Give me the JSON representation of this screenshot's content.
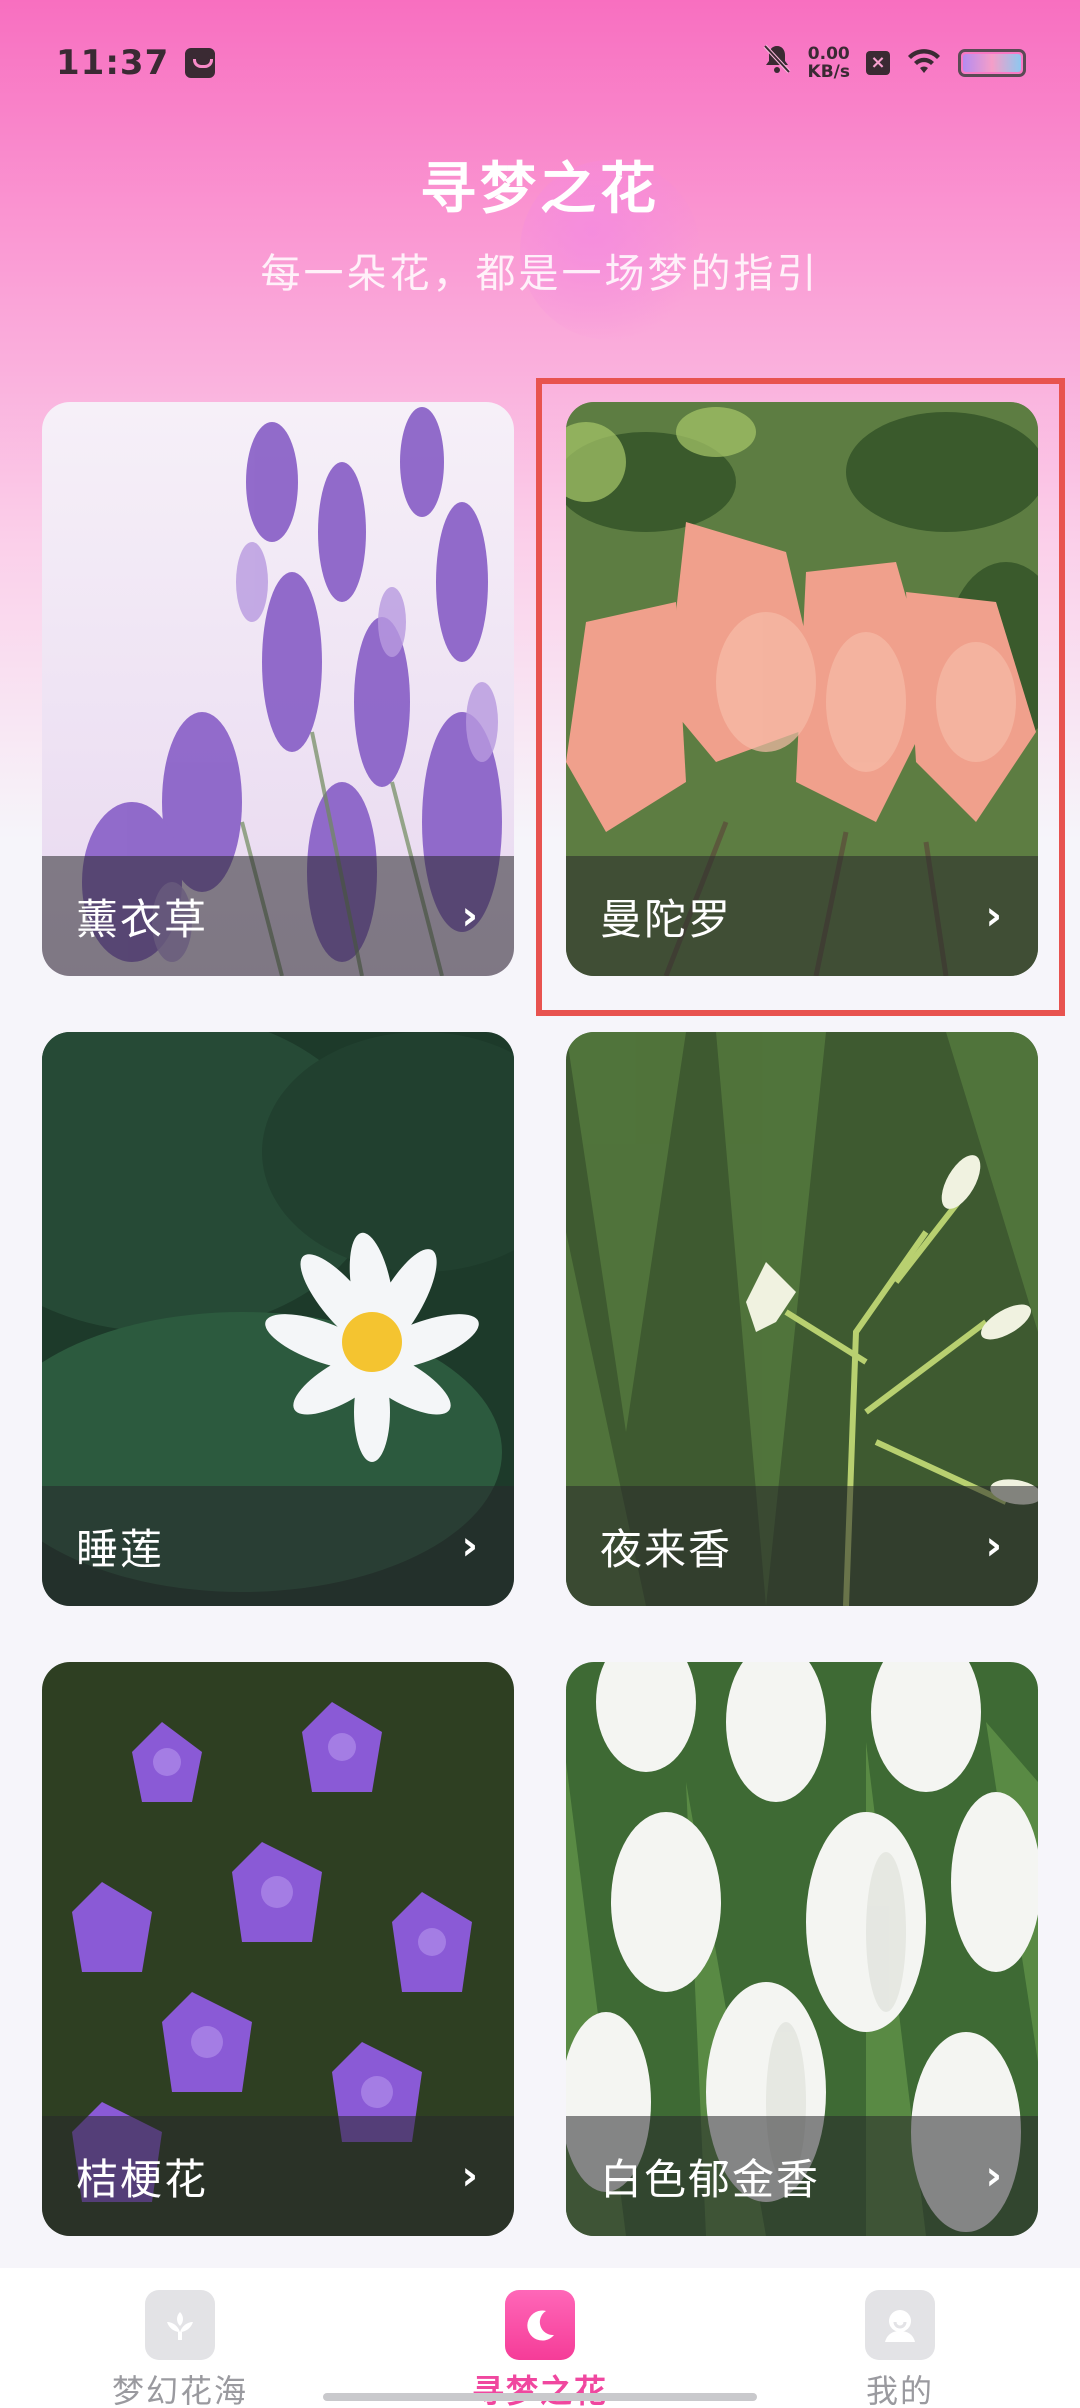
{
  "status_bar": {
    "time": "11:37",
    "net_speed_value": "0.00",
    "net_speed_unit": "KB/s"
  },
  "header": {
    "title": "寻梦之花",
    "subtitle": "每一朵花，都是一场梦的指引"
  },
  "flowers": [
    {
      "name": "薰衣草",
      "chevron": "›"
    },
    {
      "name": "曼陀罗",
      "chevron": "›"
    },
    {
      "name": "睡莲",
      "chevron": "›"
    },
    {
      "name": "夜来香",
      "chevron": "›"
    },
    {
      "name": "桔梗花",
      "chevron": "›"
    },
    {
      "name": "白色郁金香",
      "chevron": "›"
    }
  ],
  "bottom_nav": {
    "items": [
      {
        "label": "梦幻花海",
        "active": false,
        "icon": "flower-icon"
      },
      {
        "label": "寻梦之花",
        "active": true,
        "icon": "moon-icon"
      },
      {
        "label": "我的",
        "active": false,
        "icon": "profile-icon"
      }
    ]
  },
  "colors": {
    "accent": "#f0479f",
    "header_gradient_top": "#f86fc0",
    "selection_frame": "#e8534f"
  }
}
